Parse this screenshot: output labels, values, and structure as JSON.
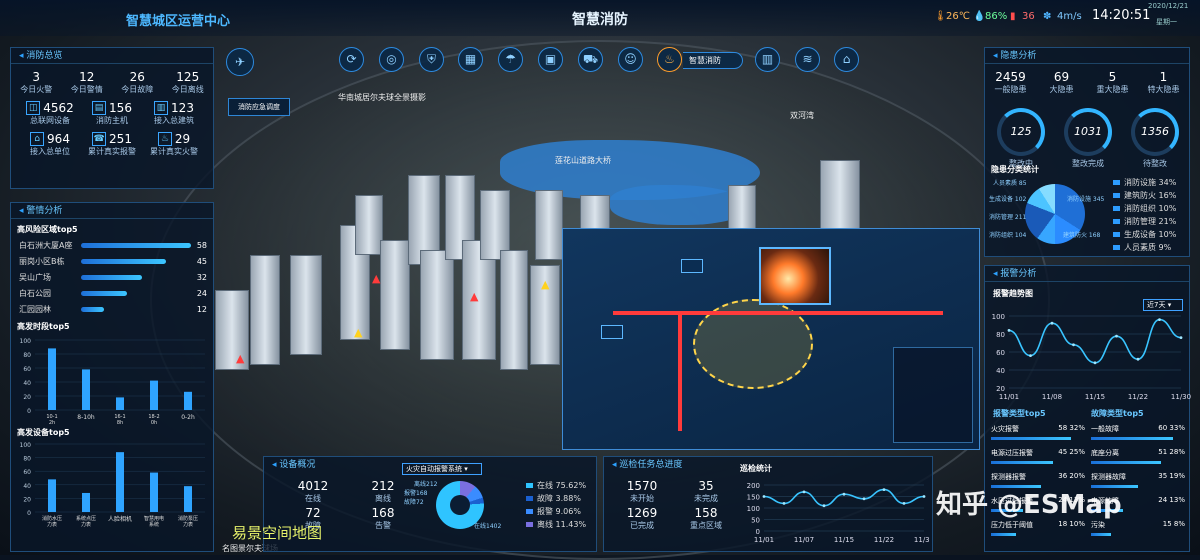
{
  "header": {
    "left_title": "智慧城区运营中心",
    "center_title": "智慧消防",
    "temperature": "26℃",
    "humidity": "86%",
    "pm": "36",
    "wind": "4m/s",
    "time": "14:20:51",
    "date": "2020/12/21",
    "weekday": "星期一"
  },
  "nav": {
    "buttons": [
      "share",
      "globe",
      "shield",
      "grid",
      "umbrella",
      "bus",
      "truck",
      "walk",
      "fire",
      "building",
      "chart",
      "bag"
    ],
    "active_label": "智慧消防"
  },
  "scene_labels": {
    "dispatch": "消防应急调度",
    "road1": "华南城居尔夫球全景摄影",
    "road2": "莲花山道路大桥",
    "road3": "双河湾",
    "bottom": "名图景尔夫球场"
  },
  "fire_overview": {
    "title": "消防总览",
    "stats": [
      {
        "value": "3",
        "label": "今日火警"
      },
      {
        "value": "12",
        "label": "今日警情"
      },
      {
        "value": "26",
        "label": "今日故障"
      },
      {
        "value": "125",
        "label": "今日离线"
      }
    ],
    "icons": [
      {
        "value": "4562",
        "label": "总联网设备"
      },
      {
        "value": "156",
        "label": "消防主机"
      },
      {
        "value": "123",
        "label": "接入总建筑"
      },
      {
        "value": "964",
        "label": "接入总单位"
      },
      {
        "value": "251",
        "label": "累计真实报警"
      },
      {
        "value": "29",
        "label": "累计真实火警"
      }
    ]
  },
  "alarm_analysis": {
    "title": "警情分析",
    "top_region_title": "高风险区域top5",
    "regions": [
      {
        "name": "白石洲大厦A座",
        "value": 58
      },
      {
        "name": "丽岗小区B栋",
        "value": 45
      },
      {
        "name": "吴山广场",
        "value": 32
      },
      {
        "name": "白石公园",
        "value": 24
      },
      {
        "name": "汇园园林",
        "value": 12
      }
    ],
    "period_title": "高发时段top5",
    "periods": [
      "10-12h",
      "8-10h",
      "16-18h",
      "18-20h",
      "0-2h"
    ],
    "period_values": [
      88,
      58,
      18,
      42,
      26
    ],
    "device_title": "高发设备top5",
    "devices": [
      "消防水压力表",
      "系统点压力表",
      "人脸相机",
      "智慧用电系统",
      "消防泵压力表"
    ],
    "device_values": [
      48,
      28,
      88,
      58,
      38
    ],
    "yticks": [
      "100",
      "80",
      "60",
      "40",
      "20",
      "0"
    ]
  },
  "hidden_danger": {
    "title": "隐患分析",
    "stats": [
      {
        "value": "2459",
        "label": "一般隐患"
      },
      {
        "value": "69",
        "label": "大隐患"
      },
      {
        "value": "5",
        "label": "重大隐患"
      },
      {
        "value": "1",
        "label": "特大隐患"
      }
    ],
    "gauges": [
      {
        "value": "125",
        "label": "整改中"
      },
      {
        "value": "1031",
        "label": "整改完成"
      },
      {
        "value": "1356",
        "label": "待整改"
      }
    ],
    "cat_title": "隐患分类统计",
    "cats": [
      {
        "name": "消防设施",
        "pct": "34%"
      },
      {
        "name": "建筑防火",
        "pct": "16%"
      },
      {
        "name": "消防组织",
        "pct": "10%"
      },
      {
        "name": "消防管理",
        "pct": "21%"
      },
      {
        "name": "生成设备",
        "pct": "10%"
      },
      {
        "name": "人员素质",
        "pct": "9%"
      }
    ],
    "pie_labels": [
      "人员素质 85",
      "生成设备 102",
      "消防管理 211",
      "消防组织 104",
      "建筑防火 168",
      "消防设施 345"
    ]
  },
  "report_analysis": {
    "title": "报警分析",
    "trend_title": "报警趋势图",
    "range": "近7天",
    "x": [
      "11/01",
      "11/08",
      "11/15",
      "11/22",
      "11/30"
    ],
    "yticks": [
      "100",
      "80",
      "60",
      "40",
      "20"
    ],
    "type_title": "报警类型top5",
    "fault_title": "故障类型top5",
    "types": [
      {
        "name": "火灾报警",
        "value": "58",
        "pct": "32%"
      },
      {
        "name": "电源过压报警",
        "value": "45",
        "pct": "25%"
      },
      {
        "name": "探测器报警",
        "value": "36",
        "pct": "20%"
      },
      {
        "name": "水压过低报警",
        "value": "24",
        "pct": "13%"
      },
      {
        "name": "压力低于阈值",
        "value": "18",
        "pct": "10%"
      }
    ],
    "faults": [
      {
        "name": "一般故障",
        "value": "60",
        "pct": "33%"
      },
      {
        "name": "底座分离",
        "value": "51",
        "pct": "28%"
      },
      {
        "name": "探测器故障",
        "value": "35",
        "pct": "19%"
      },
      {
        "name": "电源故障",
        "value": "24",
        "pct": "13%"
      },
      {
        "name": "污染",
        "value": "15",
        "pct": "8%"
      }
    ]
  },
  "device_overview": {
    "title": "设备概况",
    "stats": [
      {
        "value": "4012",
        "label": "在线"
      },
      {
        "value": "212",
        "label": "离线"
      },
      {
        "value": "72",
        "label": "故障"
      },
      {
        "value": "168",
        "label": "告警"
      }
    ],
    "select": "火灾自动报警系统",
    "donut_labels": [
      "离线212",
      "报警168",
      "故障72",
      "在线1402"
    ],
    "legend": [
      {
        "name": "在线",
        "pct": "75.62%"
      },
      {
        "name": "故障",
        "pct": "3.88%"
      },
      {
        "name": "报警",
        "pct": "9.06%"
      },
      {
        "name": "离线",
        "pct": "11.43%"
      }
    ]
  },
  "patrol": {
    "title": "巡检任务总进度",
    "stats": [
      {
        "value": "1570",
        "label": "未开始"
      },
      {
        "value": "35",
        "label": "未完成"
      },
      {
        "value": "1269",
        "label": "已完成"
      },
      {
        "value": "158",
        "label": "重点区域"
      }
    ],
    "chart_title": "巡检统计",
    "x": [
      "11/01",
      "11/07",
      "11/15",
      "11/22",
      "11/30"
    ],
    "yticks": [
      "200",
      "150",
      "100",
      "50",
      "0"
    ]
  },
  "watermark": {
    "zhihu": "知乎 @ESMap",
    "esmap": "易景空间地图"
  },
  "chart_data": [
    {
      "type": "bar",
      "title": "高发时段top5",
      "categories": [
        "10-12h",
        "8-10h",
        "16-18h",
        "18-20h",
        "0-2h"
      ],
      "values": [
        88,
        58,
        18,
        42,
        26
      ],
      "ylim": [
        0,
        100
      ]
    },
    {
      "type": "bar",
      "title": "高发设备top5",
      "categories": [
        "消防水压力表",
        "系统点压力表",
        "人脸相机",
        "智慧用电系统",
        "消防泵压力表"
      ],
      "values": [
        48,
        28,
        88,
        58,
        38
      ],
      "ylim": [
        0,
        100
      ]
    },
    {
      "type": "line",
      "title": "报警趋势图",
      "x": [
        "11/01",
        "11/08",
        "11/15",
        "11/22",
        "11/30"
      ],
      "values": [
        80,
        45,
        90,
        60,
        35,
        72,
        40,
        95,
        70
      ],
      "ylim": [
        0,
        100
      ]
    },
    {
      "type": "line",
      "title": "巡检统计",
      "x": [
        "11/01",
        "11/07",
        "11/15",
        "11/22",
        "11/30"
      ],
      "values": [
        150,
        120,
        170,
        110,
        160,
        140,
        180,
        120,
        150
      ],
      "ylim": [
        0,
        200
      ]
    }
  ]
}
